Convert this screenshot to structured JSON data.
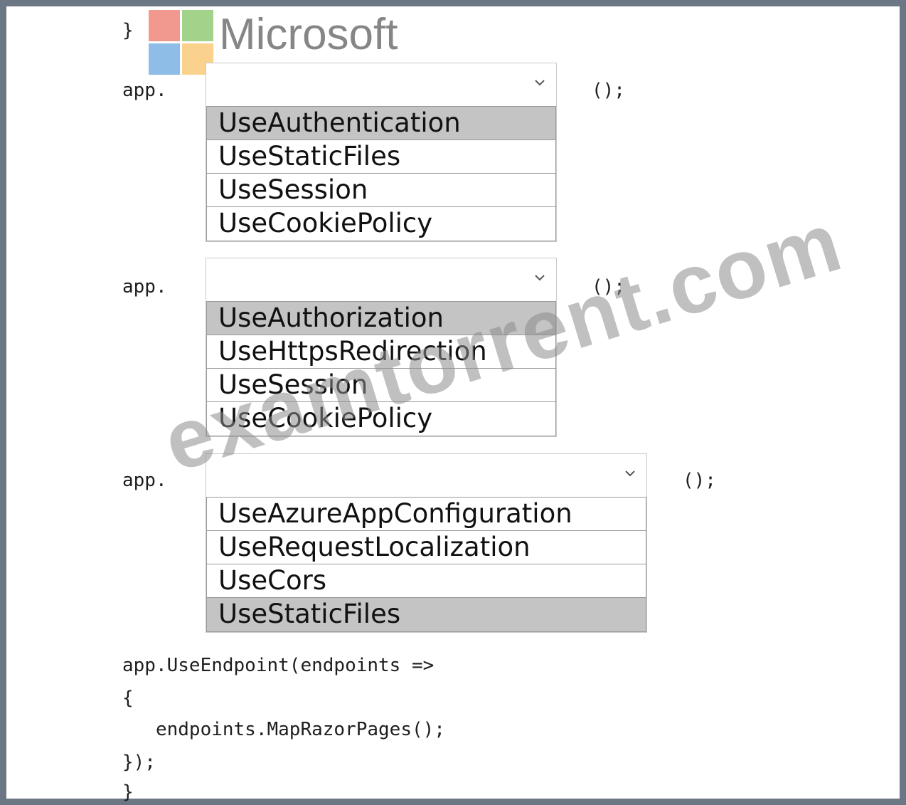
{
  "brand": {
    "logo_text": "Microsoft",
    "logo_colors": [
      "#f1998f",
      "#a3d38b",
      "#8ebde8",
      "#fbd28d"
    ]
  },
  "watermark": "examtorrent.com",
  "code": {
    "closing_brace_top": "}",
    "app_prefix": "app.",
    "call_suffix": "();",
    "use_endpoint": "app.UseEndpoint(endpoints =>",
    "open_brace": "{",
    "map_razor": "   endpoints.MapRazorPages();",
    "close_lambda": "});",
    "closing_brace_bottom": "}"
  },
  "dropdowns": [
    {
      "value": "",
      "options": [
        "UseAuthentication",
        "UseStaticFiles",
        "UseSession",
        "UseCookiePolicy"
      ],
      "selected_index": 0
    },
    {
      "value": "",
      "options": [
        "UseAuthorization",
        "UseHttpsRedirection",
        "UseSession",
        "UseCookiePolicy"
      ],
      "selected_index": 0
    },
    {
      "value": "",
      "options": [
        "UseAzureAppConfiguration",
        "UseRequestLocalization",
        "UseCors",
        "UseStaticFiles"
      ],
      "selected_index": 3
    }
  ],
  "colors": {
    "frame": "#6b7785",
    "selected_option": "#c4c4c4"
  },
  "icons": {
    "dropdown_toggle": "chevron-down-icon",
    "brand": "microsoft-logo"
  }
}
